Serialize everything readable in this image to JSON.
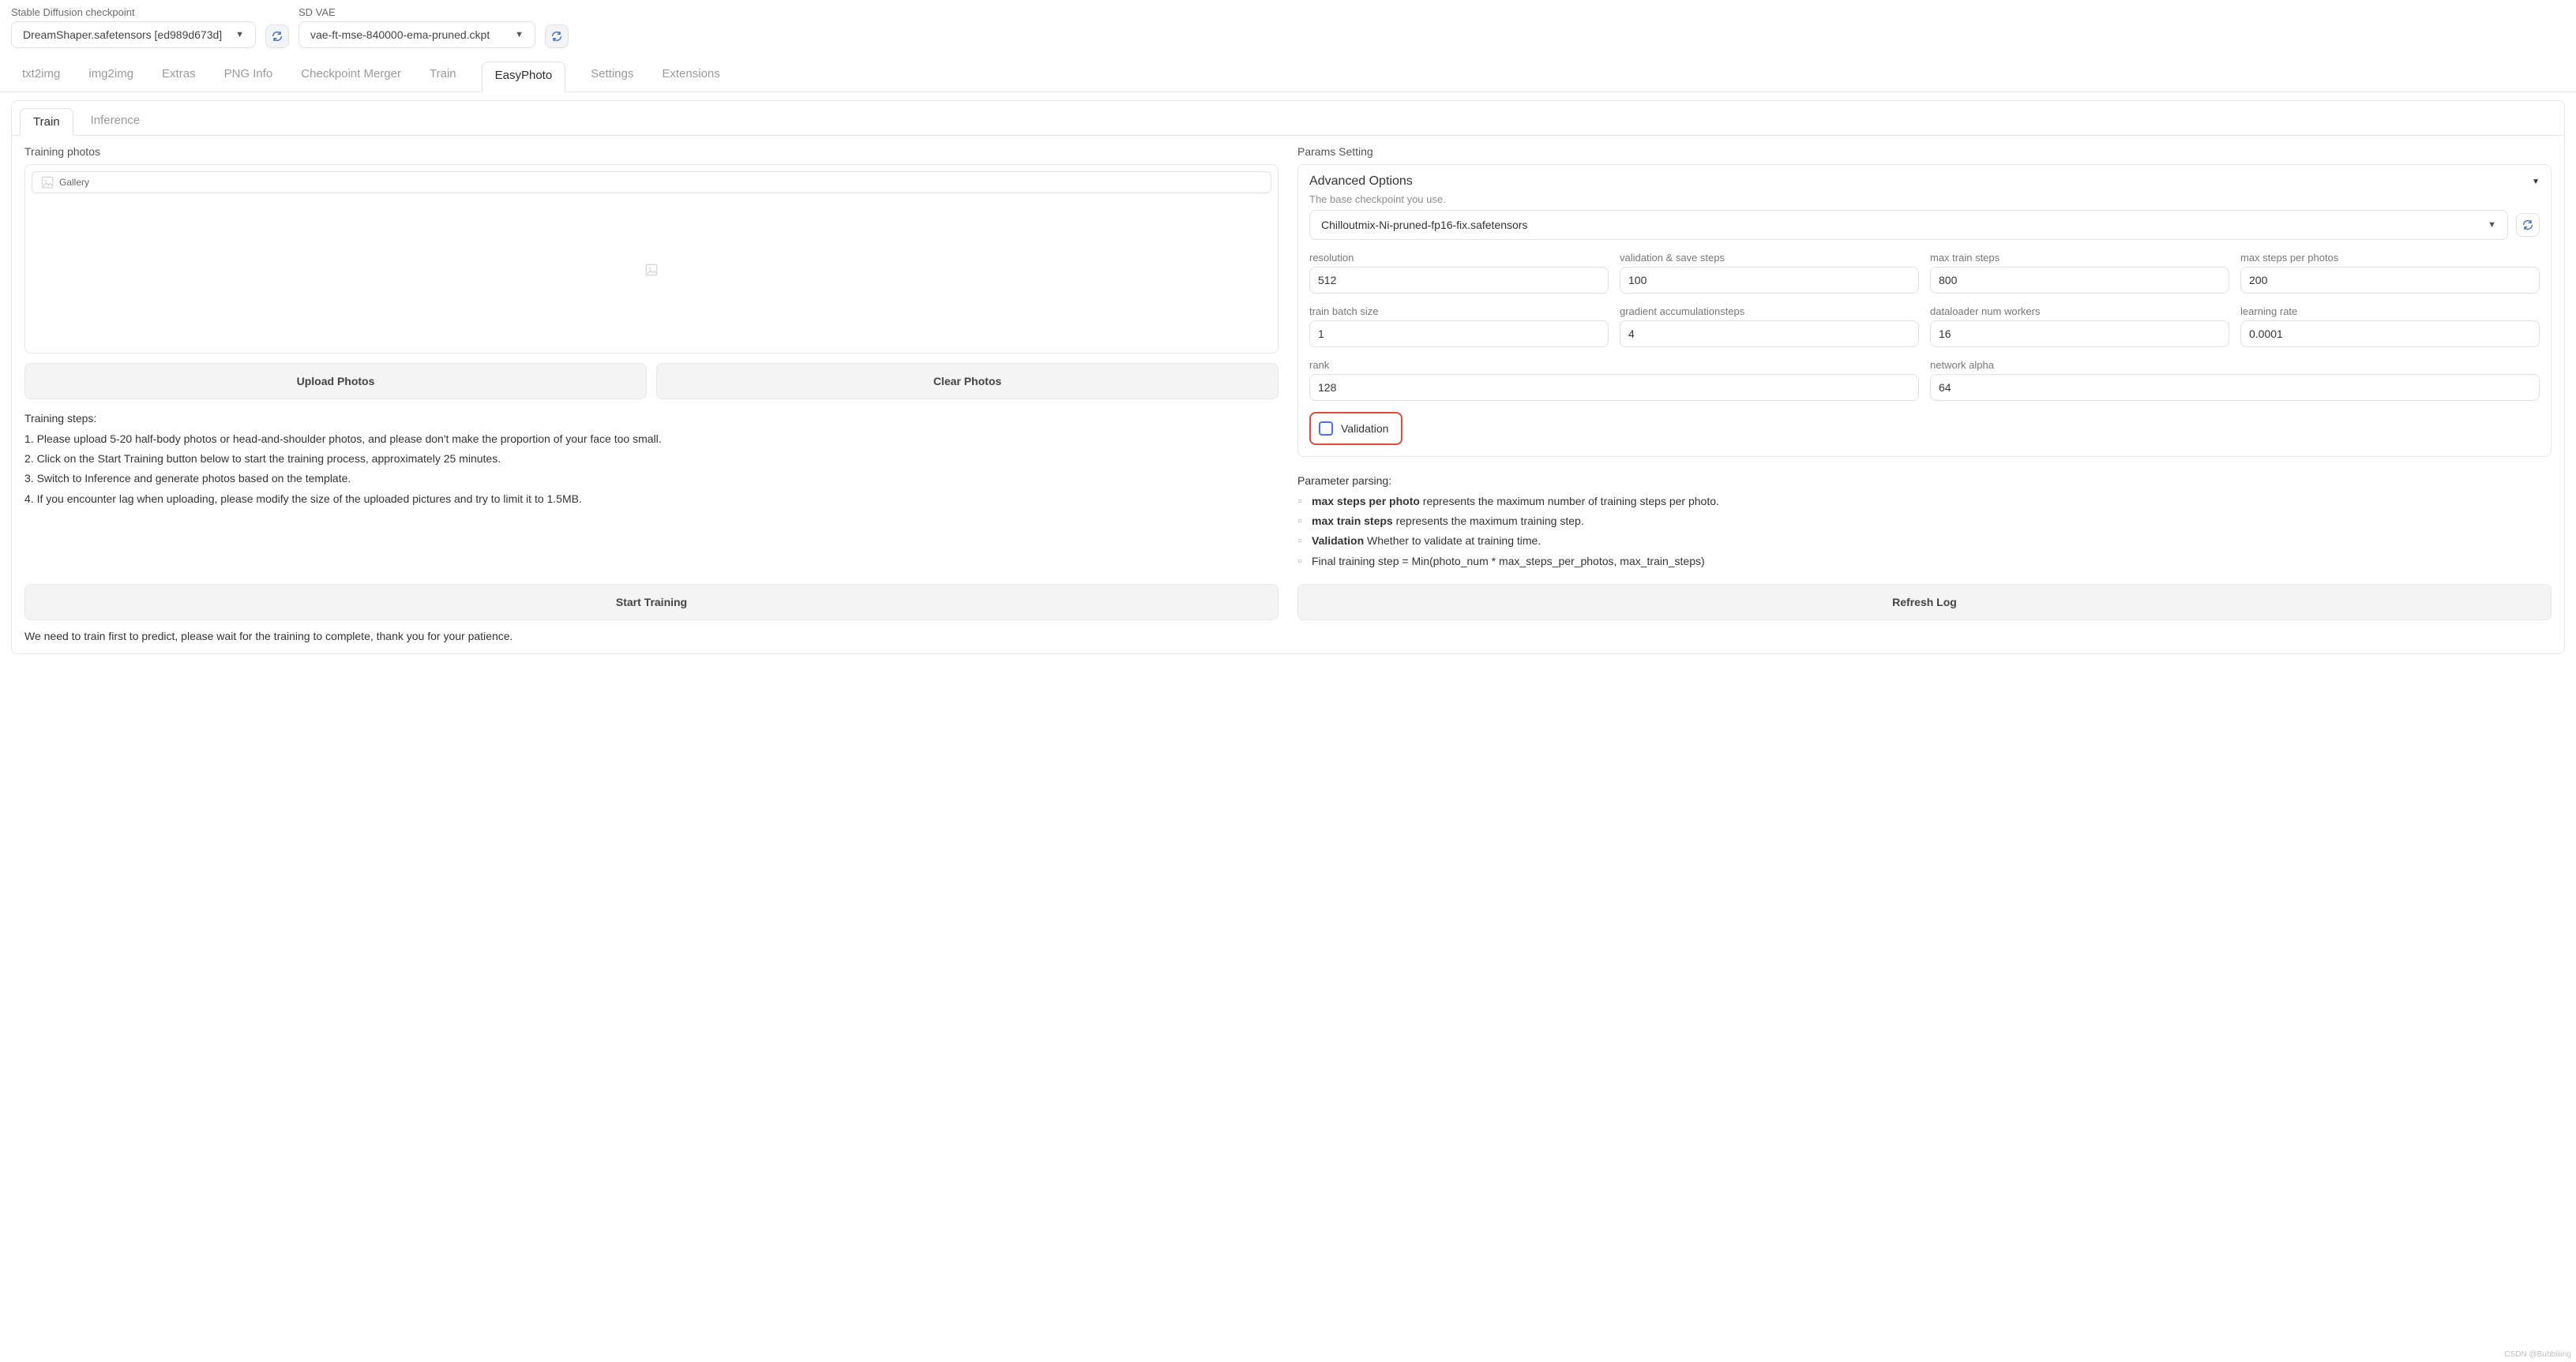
{
  "top": {
    "sd_checkpoint_label": "Stable Diffusion checkpoint",
    "sd_checkpoint_value": "DreamShaper.safetensors [ed989d673d]",
    "sd_vae_label": "SD VAE",
    "sd_vae_value": "vae-ft-mse-840000-ema-pruned.ckpt"
  },
  "tabs": {
    "0": "txt2img",
    "1": "img2img",
    "2": "Extras",
    "3": "PNG Info",
    "4": "Checkpoint Merger",
    "5": "Train",
    "6": "EasyPhoto",
    "7": "Settings",
    "8": "Extensions"
  },
  "subtabs": {
    "0": "Train",
    "1": "Inference"
  },
  "left": {
    "training_photos": "Training photos",
    "gallery": "Gallery",
    "upload": "Upload Photos",
    "clear": "Clear Photos",
    "steps_title": "Training steps:",
    "s1": "1. Please upload 5-20 half-body photos or head-and-shoulder photos, and please don't make the proportion of your face too small.",
    "s2": "2. Click on the Start Training button below to start the training process, approximately 25 minutes.",
    "s3": "3. Switch to Inference and generate photos based on the template.",
    "s4": "4. If you encounter lag when uploading, please modify the size of the uploaded pictures and try to limit it to 1.5MB."
  },
  "right": {
    "params_setting": "Params Setting",
    "advanced": "Advanced Options",
    "base_ckpt_label": "The base checkpoint you use.",
    "base_ckpt_value": "Chilloutmix-Ni-pruned-fp16-fix.safetensors",
    "fields": {
      "resolution": {
        "label": "resolution",
        "value": "512"
      },
      "val_save": {
        "label": "validation & save steps",
        "value": "100"
      },
      "max_train": {
        "label": "max train steps",
        "value": "800"
      },
      "max_pp": {
        "label": "max steps per photos",
        "value": "200"
      },
      "batch": {
        "label": "train batch size",
        "value": "1"
      },
      "grad": {
        "label": "gradient accumulationsteps",
        "value": "4"
      },
      "workers": {
        "label": "dataloader num workers",
        "value": "16"
      },
      "lr": {
        "label": "learning rate",
        "value": "0.0001"
      },
      "rank": {
        "label": "rank",
        "value": "128"
      },
      "alpha": {
        "label": "network alpha",
        "value": "64"
      }
    },
    "validation": "Validation",
    "parsing_title": "Parameter parsing:",
    "b1_strong": "max steps per photo",
    "b1_rest": " represents the maximum number of training steps per photo.",
    "b2_strong": "max train steps",
    "b2_rest": " represents the maximum training step.",
    "b3_strong": "Validation",
    "b3_rest": " Whether to validate at training time.",
    "b4": "Final training step = Min(photo_num * max_steps_per_photos, max_train_steps)"
  },
  "bottom": {
    "start": "Start Training",
    "refresh": "Refresh Log",
    "note": "We need to train first to predict, please wait for the training to complete, thank you for your patience."
  },
  "watermark": "CSDN @Bubbliiing"
}
